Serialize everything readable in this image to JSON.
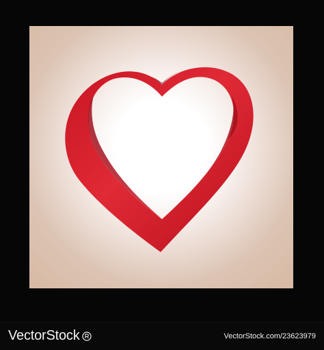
{
  "image": {
    "subject": "heart-icon",
    "colors": {
      "outer_background": "#070708",
      "panel_beige": "#d7b9a4",
      "panel_center": "#ffffff",
      "heart_red": "#d31f2c",
      "heart_shadow": "#8f101a"
    }
  },
  "footer": {
    "brand": "VectorStock",
    "credit": "VectorStock.com/23623979"
  }
}
